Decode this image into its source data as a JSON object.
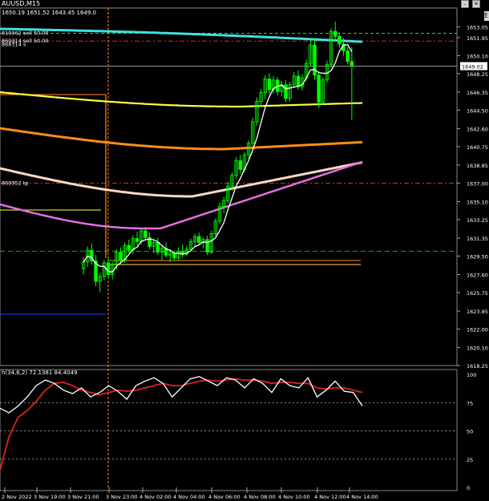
{
  "header": {
    "symbol": "AUUSD,M15",
    "ohlc_text": "1650.19 1651.52 1643.45 1649.0",
    "indicator_text": "h(34,6,2) 72.1381 84.4049"
  },
  "order_labels": [
    {
      "text": "819362 sell 50.00",
      "price": 1652.4
    },
    {
      "text": "869314 sell 50.00",
      "price": 1651.6
    },
    {
      "text": "868314 s",
      "price": 1651.25
    },
    {
      "text": "869352 tp",
      "price": 1637.0
    }
  ],
  "side_tab_label": "E",
  "chart_data": [
    {
      "type": "candlestick",
      "name": "AUUSD,M15",
      "ylim": [
        1618.25,
        1654.5
      ],
      "y_ticks": [
        "1653.05",
        "1651.95",
        "1650.10",
        "1648.25",
        "1646.35",
        "1644.50",
        "1642.60",
        "1640.75",
        "1638.85",
        "1637.00",
        "1635.10",
        "1633.25",
        "1631.35",
        "1629.50",
        "1627.60",
        "1625.75",
        "1623.85",
        "1622.00",
        "1620.10",
        "1618.25"
      ],
      "x_ticks": [
        "2 Nov 2022",
        "3 Nov 19:00",
        "3 Nov 21:00",
        "3 Nov 23:00",
        "4 Nov 02:00",
        "4 Nov 04:00",
        "4 Nov 06:00",
        "4 Nov 08:00",
        "4 Nov 10:00",
        "4 Nov 12:00",
        "4 Nov 14:00"
      ],
      "current_price": "1649.02",
      "candles": [
        [
          1628.2,
          1629.4,
          1627.6,
          1628.9
        ],
        [
          1628.9,
          1630.5,
          1628.4,
          1630.1
        ],
        [
          1630.1,
          1630.8,
          1628.6,
          1629.0
        ],
        [
          1629.0,
          1629.6,
          1626.4,
          1626.9
        ],
        [
          1626.9,
          1627.8,
          1625.8,
          1627.4
        ],
        [
          1627.4,
          1629.1,
          1627.0,
          1628.8
        ],
        [
          1628.8,
          1629.3,
          1627.2,
          1627.6
        ],
        [
          1627.6,
          1628.9,
          1627.1,
          1628.6
        ],
        [
          1628.6,
          1630.2,
          1628.1,
          1629.9
        ],
        [
          1629.9,
          1630.4,
          1628.7,
          1629.1
        ],
        [
          1629.1,
          1630.9,
          1628.8,
          1630.6
        ],
        [
          1630.6,
          1631.2,
          1629.8,
          1630.1
        ],
        [
          1630.1,
          1631.6,
          1629.7,
          1631.3
        ],
        [
          1631.3,
          1632.0,
          1630.6,
          1631.0
        ],
        [
          1631.0,
          1632.4,
          1630.7,
          1632.1
        ],
        [
          1632.1,
          1632.5,
          1631.1,
          1631.4
        ],
        [
          1631.4,
          1631.9,
          1630.2,
          1630.5
        ],
        [
          1630.5,
          1631.2,
          1629.8,
          1630.9
        ],
        [
          1630.9,
          1631.4,
          1629.6,
          1629.9
        ],
        [
          1629.9,
          1630.6,
          1629.1,
          1630.3
        ],
        [
          1630.3,
          1630.9,
          1629.3,
          1629.6
        ],
        [
          1629.6,
          1630.2,
          1628.9,
          1629.8
        ],
        [
          1629.8,
          1630.1,
          1629.0,
          1629.3
        ],
        [
          1629.3,
          1630.4,
          1629.1,
          1630.0
        ],
        [
          1630.0,
          1630.7,
          1629.4,
          1629.7
        ],
        [
          1629.7,
          1630.5,
          1629.5,
          1630.2
        ],
        [
          1630.2,
          1631.3,
          1630.0,
          1631.0
        ],
        [
          1631.0,
          1631.8,
          1630.5,
          1631.5
        ],
        [
          1631.5,
          1631.9,
          1630.7,
          1630.9
        ],
        [
          1630.9,
          1631.4,
          1630.3,
          1631.2
        ],
        [
          1631.2,
          1631.6,
          1629.6,
          1629.9
        ],
        [
          1629.9,
          1632.1,
          1629.7,
          1631.8
        ],
        [
          1631.8,
          1633.4,
          1631.5,
          1633.1
        ],
        [
          1633.1,
          1635.0,
          1632.8,
          1634.6
        ],
        [
          1634.6,
          1635.6,
          1633.9,
          1635.2
        ],
        [
          1635.2,
          1637.1,
          1634.9,
          1636.7
        ],
        [
          1636.7,
          1638.1,
          1636.2,
          1637.8
        ],
        [
          1637.8,
          1639.7,
          1637.4,
          1639.3
        ],
        [
          1639.3,
          1639.9,
          1637.9,
          1638.4
        ],
        [
          1638.4,
          1640.2,
          1638.1,
          1639.9
        ],
        [
          1639.9,
          1641.4,
          1639.5,
          1641.1
        ],
        [
          1641.1,
          1643.7,
          1640.8,
          1643.3
        ],
        [
          1643.3,
          1645.8,
          1642.9,
          1645.4
        ],
        [
          1645.4,
          1646.7,
          1644.9,
          1646.3
        ],
        [
          1646.3,
          1648.1,
          1645.6,
          1647.7
        ],
        [
          1647.7,
          1648.3,
          1646.1,
          1646.6
        ],
        [
          1646.6,
          1648.0,
          1646.2,
          1647.6
        ],
        [
          1647.6,
          1647.9,
          1646.0,
          1646.4
        ],
        [
          1646.4,
          1647.5,
          1645.9,
          1647.1
        ],
        [
          1647.1,
          1647.6,
          1645.3,
          1645.7
        ],
        [
          1645.7,
          1647.4,
          1645.4,
          1647.1
        ],
        [
          1647.1,
          1648.4,
          1646.8,
          1648.0
        ],
        [
          1648.0,
          1648.6,
          1646.6,
          1646.9
        ],
        [
          1646.9,
          1648.2,
          1646.5,
          1647.8
        ],
        [
          1647.8,
          1649.7,
          1647.5,
          1649.3
        ],
        [
          1649.3,
          1651.7,
          1649.0,
          1651.2
        ],
        [
          1651.2,
          1651.8,
          1647.6,
          1648.1
        ],
        [
          1648.1,
          1648.5,
          1644.7,
          1645.3
        ],
        [
          1645.3,
          1647.9,
          1645.0,
          1647.6
        ],
        [
          1647.6,
          1649.6,
          1647.3,
          1649.2
        ],
        [
          1649.2,
          1652.9,
          1648.9,
          1652.6
        ],
        [
          1652.6,
          1653.6,
          1651.6,
          1652.1
        ],
        [
          1652.1,
          1652.5,
          1650.9,
          1651.3
        ],
        [
          1651.3,
          1651.9,
          1650.1,
          1650.6
        ],
        [
          1650.6,
          1651.0,
          1649.2,
          1649.5
        ],
        [
          1649.5,
          1651.0,
          1643.5,
          1649.0
        ]
      ],
      "first_candle_index": -6
    },
    {
      "type": "line",
      "name": "h(34,6,2)",
      "ylim": [
        0,
        100
      ],
      "y_ticks": [
        "100",
        "75",
        "50",
        "25",
        "0"
      ],
      "values": [
        72.1381,
        84.4049
      ]
    }
  ],
  "colors": {
    "background": "#000000",
    "grid": "#2a2a2a",
    "bull": "#00ff00",
    "bear": "#00ff00",
    "cyan_ma": "#40e0e0",
    "yellow_ma": "#ffff40",
    "orange_ma": "#ff8c1a",
    "peach_ma": "#ffd8c0",
    "violet_ma": "#e070e0",
    "fast_ma": "#ffffff",
    "sell_line": "#ff3030",
    "tp_line": "#00c000",
    "orange_vline": "#ff8c1a",
    "stoch_main": "#ffffff",
    "stoch_signal": "#e02020"
  }
}
